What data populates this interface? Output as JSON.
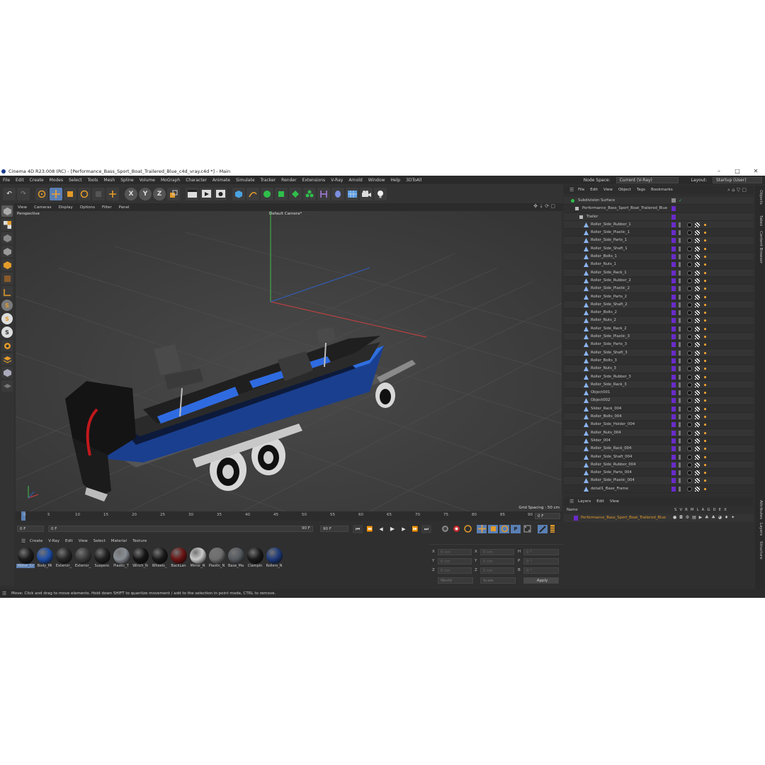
{
  "window": {
    "title": "Cinema 4D R23.008 (RC) - [Performance_Bass_Sport_Boat_Trailered_Blue_c4d_vray.c4d *] - Main",
    "minimize": "–",
    "maximize": "□",
    "close": "✕"
  },
  "menu": {
    "items": [
      "File",
      "Edit",
      "Create",
      "Modes",
      "Select",
      "Tools",
      "Mesh",
      "Spline",
      "Volume",
      "MoGraph",
      "Character",
      "Animate",
      "Simulate",
      "Tracker",
      "Render",
      "Extensions",
      "V-Ray",
      "Arnold",
      "Window",
      "Help",
      "3DToAll"
    ],
    "node_space_label": "Node Space:",
    "node_space_value": "Current (V-Ray)",
    "layout_label": "Layout:",
    "layout_value": "Startup (User)"
  },
  "toolbar": {
    "undo": "↶",
    "redo": "↷",
    "axis_x": "X",
    "axis_y": "Y",
    "axis_z": "Z"
  },
  "viewport_menu": [
    "View",
    "Cameras",
    "Display",
    "Options",
    "Filter",
    "Panel"
  ],
  "viewport": {
    "projection": "Perspective",
    "camera": "Default Camera",
    "camera_suffix": "*",
    "grid_spacing": "Grid Spacing : 50 cm"
  },
  "timeline": {
    "ticks": [
      "0",
      "5",
      "10",
      "15",
      "20",
      "25",
      "30",
      "35",
      "40",
      "45",
      "50",
      "55",
      "60",
      "65",
      "70",
      "75",
      "80",
      "85",
      "90"
    ],
    "current_frame_right": "0 F",
    "start_frame": "0 F",
    "range_start": "0 F",
    "range_end": "90 F",
    "end_frame": "90 F"
  },
  "materials": {
    "menu": [
      "Create",
      "V-Ray",
      "Edit",
      "View",
      "Select",
      "Material",
      "Texture"
    ],
    "items": [
      {
        "label": "Motor_Cr",
        "color": "#1c1c1c"
      },
      {
        "label": "Body_Mi",
        "color": "#1f4fa8"
      },
      {
        "label": "Exterior_",
        "color": "#262626"
      },
      {
        "label": "Exterior_",
        "color": "#3a3a3a"
      },
      {
        "label": "Suspenc",
        "color": "#202020"
      },
      {
        "label": "Plastic_T",
        "color": "#8a8f96"
      },
      {
        "label": "Winch_N",
        "color": "#161616"
      },
      {
        "label": "Wheels_",
        "color": "#1a1a1a"
      },
      {
        "label": "BackLan",
        "color": "#6b1414"
      },
      {
        "label": "Mirror_N",
        "color": "#c9c9c9"
      },
      {
        "label": "Plastic_N",
        "color": "#6e6e6e"
      },
      {
        "label": "Base_Ma",
        "color": "#555a60"
      },
      {
        "label": "Clampin",
        "color": "#1a1a1a"
      },
      {
        "label": "Rollers_N",
        "color": "#1e3a7a"
      }
    ]
  },
  "coords": {
    "x_pos": "X",
    "y_pos": "Y",
    "z_pos": "Z",
    "x_size": "X",
    "y_size": "Y",
    "z_size": "Z",
    "h": "H",
    "p": "P",
    "b": "B",
    "pos_value": "0 cm",
    "rot_value": "0 °",
    "mode_world": "World",
    "mode_scale": "Scale",
    "apply": "Apply"
  },
  "objects": {
    "menu": [
      "File",
      "Edit",
      "View",
      "Object",
      "Tags",
      "Bookmarks"
    ],
    "root": "Subdivision Surface",
    "group": "Performance_Bass_Sport_Boat_Trailered_Blue",
    "subgroup": "Trailer",
    "items": [
      "Roller_Side_Rubber_1",
      "Roller_Side_Plastic_1",
      "Roller_Side_Parts_1",
      "Roller_Side_Shaft_1",
      "Roller_Bolts_1",
      "Roller_Nuts_1",
      "Roller_Side_Rack_1",
      "Roller_Side_Rubber_2",
      "Roller_Side_Plastic_2",
      "Roller_Side_Parts_2",
      "Roller_Side_Shaft_2",
      "Roller_Bolts_2",
      "Roller_Nuts_2",
      "Roller_Side_Rack_2",
      "Roller_Side_Plastic_3",
      "Roller_Side_Parts_3",
      "Roller_Side_Shaft_3",
      "Roller_Bolts_3",
      "Roller_Nuts_3",
      "Roller_Side_Rubber_3",
      "Roller_Side_Rack_3",
      "Object001",
      "Object002",
      "Slider_Rack_004",
      "Roller_Bolts_004",
      "Roller_Side_Holder_004",
      "Roller_Nuts_004",
      "Slider_004",
      "Roller_Side_Rack_004",
      "Roller_Side_Shaft_004",
      "Roller_Side_Rubber_004",
      "Roller_Side_Parts_004",
      "Roller_Side_Plastic_004",
      "detail1_Base_Frame"
    ]
  },
  "layers": {
    "menu": [
      "Layers",
      "Edit",
      "View"
    ],
    "name_header": "Name",
    "flag_headers": "S V R M L A G D E X",
    "layer_name": "Performance_Bass_Sport_Boat_Trailered_Blue"
  },
  "side_tabs": [
    "Objects",
    "Takes",
    "Content Browser",
    "Attributes",
    "Layers",
    "Structure"
  ],
  "status": "Move: Click and drag to move elements. Hold down SHIFT to quantize movement / add to the selection in point mode, CTRL to remove."
}
